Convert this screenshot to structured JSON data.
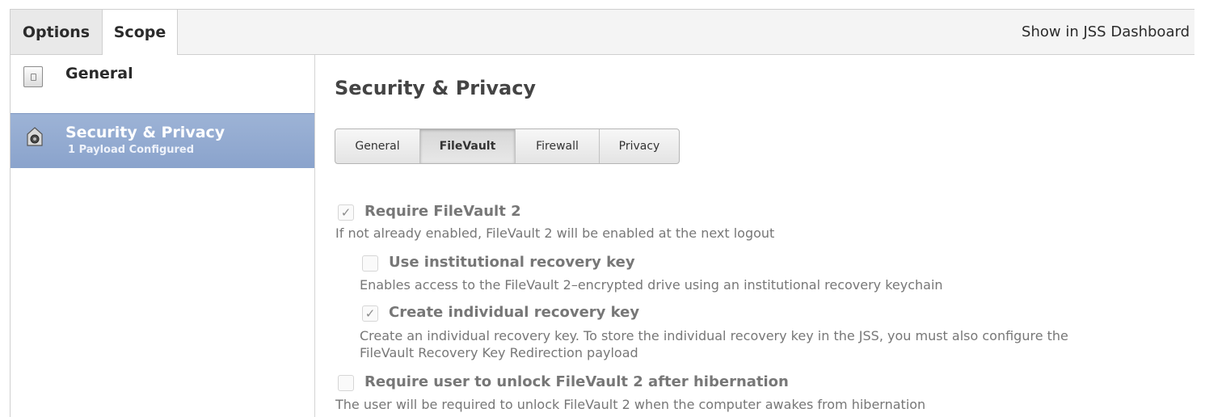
{
  "header": {
    "tabs": [
      {
        "label": "Options",
        "active": false
      },
      {
        "label": "Scope",
        "active": true
      }
    ],
    "dashboard_label": "Show in JSS Dashboard"
  },
  "sidebar": {
    "items": [
      {
        "icon": "document-icon",
        "title": "General",
        "subtitle": "",
        "selected": false
      },
      {
        "icon": "security-privacy-icon",
        "title": "Security & Privacy",
        "subtitle": "1 Payload Configured",
        "selected": true
      }
    ],
    "selected_color": "#8fa8cf"
  },
  "main": {
    "title": "Security & Privacy",
    "segments": [
      {
        "label": "General",
        "selected": false
      },
      {
        "label": "FileVault",
        "selected": true
      },
      {
        "label": "Firewall",
        "selected": false
      },
      {
        "label": "Privacy",
        "selected": false
      }
    ],
    "options": [
      {
        "label": "Require FileVault 2",
        "checked": true,
        "description": "If not already enabled, FileVault 2 will be enabled at the next logout"
      },
      {
        "label": "Use institutional recovery key",
        "checked": false,
        "description": "Enables access to the FileVault 2–encrypted drive using an institutional recovery keychain"
      },
      {
        "label": "Create individual recovery key",
        "checked": true,
        "description_line1": "Create an individual recovery key. To store the individual recovery key in the JSS, you must also configure the",
        "description_line2": "FileVault Recovery Key Redirection payload"
      },
      {
        "label": "Require user to unlock FileVault 2 after hibernation",
        "checked": false,
        "description": "The user will be required to unlock FileVault 2 when the computer awakes from hibernation"
      }
    ]
  }
}
